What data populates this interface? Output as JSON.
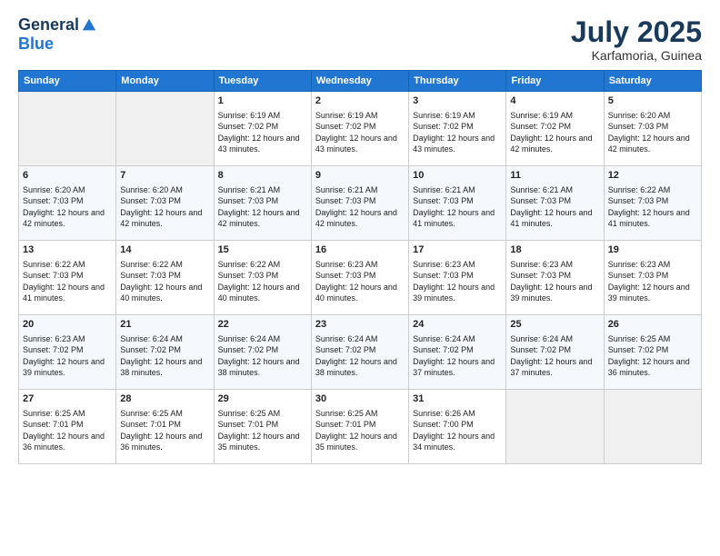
{
  "header": {
    "logo_general": "General",
    "logo_blue": "Blue",
    "month_title": "July 2025",
    "location": "Karfamoria, Guinea"
  },
  "days_of_week": [
    "Sunday",
    "Monday",
    "Tuesday",
    "Wednesday",
    "Thursday",
    "Friday",
    "Saturday"
  ],
  "weeks": [
    [
      {
        "day": "",
        "empty": true
      },
      {
        "day": "",
        "empty": true
      },
      {
        "day": "1",
        "sunrise": "Sunrise: 6:19 AM",
        "sunset": "Sunset: 7:02 PM",
        "daylight": "Daylight: 12 hours and 43 minutes."
      },
      {
        "day": "2",
        "sunrise": "Sunrise: 6:19 AM",
        "sunset": "Sunset: 7:02 PM",
        "daylight": "Daylight: 12 hours and 43 minutes."
      },
      {
        "day": "3",
        "sunrise": "Sunrise: 6:19 AM",
        "sunset": "Sunset: 7:02 PM",
        "daylight": "Daylight: 12 hours and 43 minutes."
      },
      {
        "day": "4",
        "sunrise": "Sunrise: 6:19 AM",
        "sunset": "Sunset: 7:02 PM",
        "daylight": "Daylight: 12 hours and 42 minutes."
      },
      {
        "day": "5",
        "sunrise": "Sunrise: 6:20 AM",
        "sunset": "Sunset: 7:03 PM",
        "daylight": "Daylight: 12 hours and 42 minutes."
      }
    ],
    [
      {
        "day": "6",
        "sunrise": "Sunrise: 6:20 AM",
        "sunset": "Sunset: 7:03 PM",
        "daylight": "Daylight: 12 hours and 42 minutes."
      },
      {
        "day": "7",
        "sunrise": "Sunrise: 6:20 AM",
        "sunset": "Sunset: 7:03 PM",
        "daylight": "Daylight: 12 hours and 42 minutes."
      },
      {
        "day": "8",
        "sunrise": "Sunrise: 6:21 AM",
        "sunset": "Sunset: 7:03 PM",
        "daylight": "Daylight: 12 hours and 42 minutes."
      },
      {
        "day": "9",
        "sunrise": "Sunrise: 6:21 AM",
        "sunset": "Sunset: 7:03 PM",
        "daylight": "Daylight: 12 hours and 42 minutes."
      },
      {
        "day": "10",
        "sunrise": "Sunrise: 6:21 AM",
        "sunset": "Sunset: 7:03 PM",
        "daylight": "Daylight: 12 hours and 41 minutes."
      },
      {
        "day": "11",
        "sunrise": "Sunrise: 6:21 AM",
        "sunset": "Sunset: 7:03 PM",
        "daylight": "Daylight: 12 hours and 41 minutes."
      },
      {
        "day": "12",
        "sunrise": "Sunrise: 6:22 AM",
        "sunset": "Sunset: 7:03 PM",
        "daylight": "Daylight: 12 hours and 41 minutes."
      }
    ],
    [
      {
        "day": "13",
        "sunrise": "Sunrise: 6:22 AM",
        "sunset": "Sunset: 7:03 PM",
        "daylight": "Daylight: 12 hours and 41 minutes."
      },
      {
        "day": "14",
        "sunrise": "Sunrise: 6:22 AM",
        "sunset": "Sunset: 7:03 PM",
        "daylight": "Daylight: 12 hours and 40 minutes."
      },
      {
        "day": "15",
        "sunrise": "Sunrise: 6:22 AM",
        "sunset": "Sunset: 7:03 PM",
        "daylight": "Daylight: 12 hours and 40 minutes."
      },
      {
        "day": "16",
        "sunrise": "Sunrise: 6:23 AM",
        "sunset": "Sunset: 7:03 PM",
        "daylight": "Daylight: 12 hours and 40 minutes."
      },
      {
        "day": "17",
        "sunrise": "Sunrise: 6:23 AM",
        "sunset": "Sunset: 7:03 PM",
        "daylight": "Daylight: 12 hours and 39 minutes."
      },
      {
        "day": "18",
        "sunrise": "Sunrise: 6:23 AM",
        "sunset": "Sunset: 7:03 PM",
        "daylight": "Daylight: 12 hours and 39 minutes."
      },
      {
        "day": "19",
        "sunrise": "Sunrise: 6:23 AM",
        "sunset": "Sunset: 7:03 PM",
        "daylight": "Daylight: 12 hours and 39 minutes."
      }
    ],
    [
      {
        "day": "20",
        "sunrise": "Sunrise: 6:23 AM",
        "sunset": "Sunset: 7:02 PM",
        "daylight": "Daylight: 12 hours and 39 minutes."
      },
      {
        "day": "21",
        "sunrise": "Sunrise: 6:24 AM",
        "sunset": "Sunset: 7:02 PM",
        "daylight": "Daylight: 12 hours and 38 minutes."
      },
      {
        "day": "22",
        "sunrise": "Sunrise: 6:24 AM",
        "sunset": "Sunset: 7:02 PM",
        "daylight": "Daylight: 12 hours and 38 minutes."
      },
      {
        "day": "23",
        "sunrise": "Sunrise: 6:24 AM",
        "sunset": "Sunset: 7:02 PM",
        "daylight": "Daylight: 12 hours and 38 minutes."
      },
      {
        "day": "24",
        "sunrise": "Sunrise: 6:24 AM",
        "sunset": "Sunset: 7:02 PM",
        "daylight": "Daylight: 12 hours and 37 minutes."
      },
      {
        "day": "25",
        "sunrise": "Sunrise: 6:24 AM",
        "sunset": "Sunset: 7:02 PM",
        "daylight": "Daylight: 12 hours and 37 minutes."
      },
      {
        "day": "26",
        "sunrise": "Sunrise: 6:25 AM",
        "sunset": "Sunset: 7:02 PM",
        "daylight": "Daylight: 12 hours and 36 minutes."
      }
    ],
    [
      {
        "day": "27",
        "sunrise": "Sunrise: 6:25 AM",
        "sunset": "Sunset: 7:01 PM",
        "daylight": "Daylight: 12 hours and 36 minutes."
      },
      {
        "day": "28",
        "sunrise": "Sunrise: 6:25 AM",
        "sunset": "Sunset: 7:01 PM",
        "daylight": "Daylight: 12 hours and 36 minutes."
      },
      {
        "day": "29",
        "sunrise": "Sunrise: 6:25 AM",
        "sunset": "Sunset: 7:01 PM",
        "daylight": "Daylight: 12 hours and 35 minutes."
      },
      {
        "day": "30",
        "sunrise": "Sunrise: 6:25 AM",
        "sunset": "Sunset: 7:01 PM",
        "daylight": "Daylight: 12 hours and 35 minutes."
      },
      {
        "day": "31",
        "sunrise": "Sunrise: 6:26 AM",
        "sunset": "Sunset: 7:00 PM",
        "daylight": "Daylight: 12 hours and 34 minutes."
      },
      {
        "day": "",
        "empty": true
      },
      {
        "day": "",
        "empty": true
      }
    ]
  ]
}
